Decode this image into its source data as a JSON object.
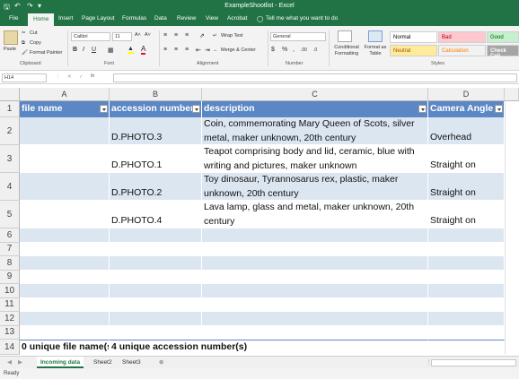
{
  "window": {
    "title": "ExampleShootlist - Excel"
  },
  "ribbon_tabs": [
    "File",
    "Home",
    "Insert",
    "Page Layout",
    "Formulas",
    "Data",
    "Review",
    "View",
    "Acrobat"
  ],
  "tell_me": "Tell me what you want to do",
  "clipboard": {
    "cut": "Cut",
    "copy": "Copy",
    "paste": "Paste",
    "format_painter": "Format Painter",
    "group": "Clipboard"
  },
  "font": {
    "name": "Calibri",
    "size": "11",
    "group": "Font"
  },
  "alignment": {
    "wrap_text": "Wrap Text",
    "merge_center": "Merge & Center",
    "group": "Alignment"
  },
  "number": {
    "format": "General",
    "group": "Number"
  },
  "styles": {
    "conditional": "Conditional Formatting",
    "format_table": "Format as Table",
    "group": "Styles",
    "cells": [
      {
        "label": "Normal",
        "bg": "#ffffff",
        "fg": "#000000"
      },
      {
        "label": "Bad",
        "bg": "#ffc7ce",
        "fg": "#9c0006"
      },
      {
        "label": "Good",
        "bg": "#c6efce",
        "fg": "#006100"
      },
      {
        "label": "Neutral",
        "bg": "#ffeb9c",
        "fg": "#9c5700"
      },
      {
        "label": "Calculation",
        "bg": "#f2f2f2",
        "fg": "#fa7d00"
      },
      {
        "label": "Check Cell",
        "bg": "#a5a5a5",
        "fg": "#ffffff"
      }
    ]
  },
  "formula_bar": {
    "name_box": "H14",
    "fx": "fx",
    "value": ""
  },
  "columns": [
    "A",
    "B",
    "C",
    "D"
  ],
  "headers": [
    "file name",
    "accession number",
    "description",
    "Camera Angle"
  ],
  "rows": [
    {
      "num": "2",
      "a": "",
      "b": "D.PHOTO.3",
      "c": "Coin, commemorating Mary Queen of Scots, silver metal, maker unknown, 20th century",
      "d": "Overhead"
    },
    {
      "num": "3",
      "a": "",
      "b": "D.PHOTO.1",
      "c": "Teapot comprising body and lid, ceramic, blue with writing and pictures, maker unknown",
      "d": "Straight on"
    },
    {
      "num": "4",
      "a": "",
      "b": "D.PHOTO.2",
      "c": "Toy dinosaur, Tyrannosarus rex, plastic, maker unknown, 20th century",
      "d": "Straight on"
    },
    {
      "num": "5",
      "a": "",
      "b": "D.PHOTO.4",
      "c": "Lava lamp, glass and metal, maker unknown, 20th century",
      "d": "Straight on"
    }
  ],
  "empty_rows": [
    "6",
    "7",
    "8",
    "9",
    "10",
    "11",
    "12",
    "13"
  ],
  "header_row_num": "1",
  "summary": {
    "num": "14",
    "a": "0 unique file name(s",
    "b": "4 unique accession number(s)"
  },
  "sheet_tabs": [
    "Incoming data",
    "Sheet2",
    "Sheet3"
  ],
  "active_sheet": "Incoming data",
  "status": "Ready",
  "colors": {
    "accent": "#217346",
    "table_header": "#5b87c5",
    "band": "#dce6f1"
  }
}
